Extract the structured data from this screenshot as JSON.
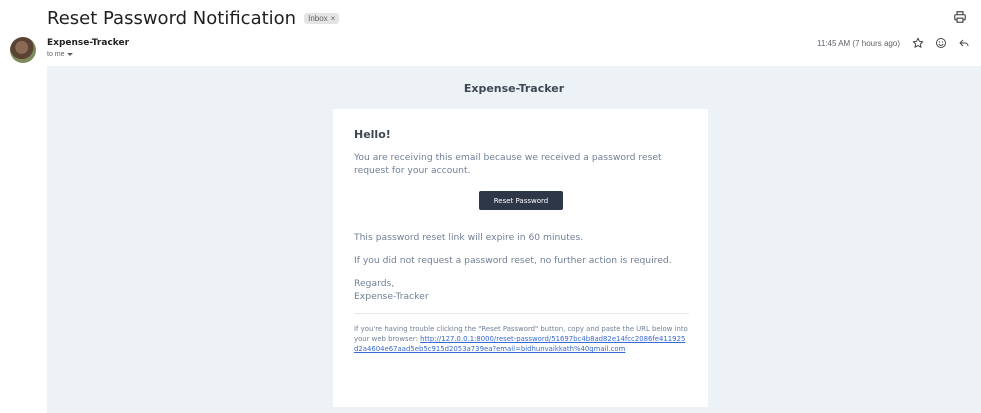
{
  "header": {
    "subject": "Reset Password Notification",
    "label_chip": "Inbox",
    "label_close": "×"
  },
  "sender": {
    "name": "Expense-Tracker",
    "to": "to me",
    "timestamp": "11:45 AM (7 hours ago)"
  },
  "email": {
    "brand": "Expense-Tracker",
    "greeting": "Hello!",
    "intro": "You are receiving this email because we received a password reset request for your account.",
    "button_label": "Reset Password",
    "expire": "This password reset link will expire in 60 minutes.",
    "no_action": "If you did not request a password reset, no further action is required.",
    "salutation": "Regards,",
    "signature": "Expense-Tracker",
    "subcopy_text": "If you're having trouble clicking the \"Reset Password\" button, copy and paste the URL below into your web browser: ",
    "subcopy_link": "http://127.0.0.1:8000/reset-password/51697bc4b8ad82e14fcc2086fe411925d2a4604e67aad5eb5c915d2053a739ea?email=bidhunvaikkath%40gmail.com"
  },
  "icons": [
    "print-icon",
    "star-icon",
    "emoji-icon",
    "reply-icon",
    "chevron-down-icon"
  ]
}
